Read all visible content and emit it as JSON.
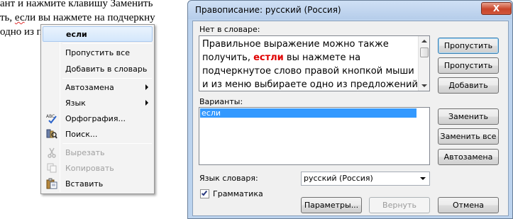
{
  "document": {
    "lines": [
      "ант и нажмите клавишу Заменить",
      "ть, ",
      "одно из п"
    ],
    "line2_squiggle": "ес",
    "line2_rest": "ли вы нажмете на подчеркну"
  },
  "context_menu": {
    "suggestion": "если",
    "ignore_all": "Пропустить все",
    "add_to_dictionary": "Добавить в словарь",
    "autocorrect": "Автозамена",
    "language": "Язык",
    "spelling": "Орфография...",
    "lookup": "Поиск...",
    "cut": "Вырезать",
    "copy": "Копировать",
    "paste": "Вставить"
  },
  "dialog": {
    "title": "Правописание: русский (Россия)",
    "close_glyph": "X",
    "not_in_dictionary_label": "Нет в словаре:",
    "sentence_before": "Правильное выражение можно также получить, ",
    "error_word": "естли",
    "sentence_after": " вы нажмете на подчеркнутое слово правой кнопкой мыши и из меню выбираете одно из предложений",
    "suggestions_label": "Варианты:",
    "suggestions": [
      "если"
    ],
    "dictionary_language_label": "Язык словаря:",
    "dictionary_language_value": "русский (Россия)",
    "grammar_label": "Грамматика",
    "grammar_checked": true,
    "buttons": {
      "ignore": "Пропустить",
      "ignore_all": "Пропустить все",
      "add": "Добавить",
      "change": "Заменить",
      "change_all": "Заменить все",
      "autocorrect": "Автозамена",
      "options": "Параметры...",
      "undo": "Вернуть",
      "cancel": "Отмена"
    }
  },
  "colors": {
    "selection": "#3399ff",
    "error_word": "#e00000",
    "title_bar": "#bcd3ee"
  }
}
